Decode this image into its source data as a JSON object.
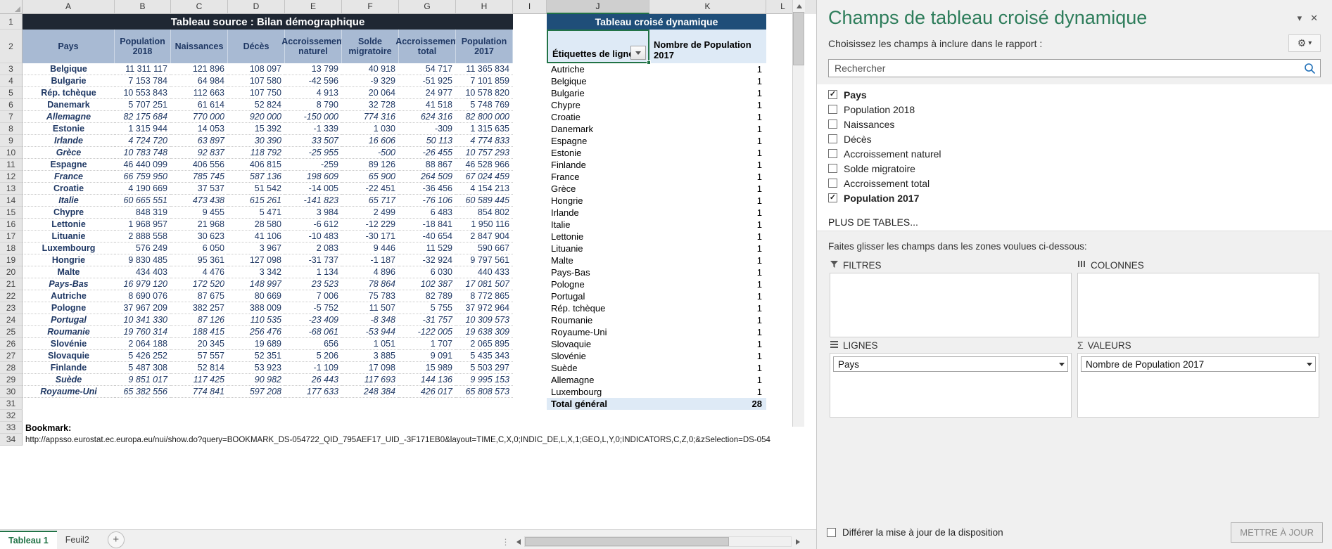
{
  "spreadsheet": {
    "column_headers": [
      "A",
      "B",
      "C",
      "D",
      "E",
      "F",
      "G",
      "H",
      "I",
      "J",
      "K",
      "L"
    ],
    "selected_column": "J",
    "row_numbers": [
      "1",
      "2",
      "3",
      "4",
      "5",
      "6",
      "7",
      "8",
      "9",
      "10",
      "11",
      "12",
      "13",
      "14",
      "15",
      "16",
      "17",
      "18",
      "19",
      "20",
      "21",
      "22",
      "23",
      "24",
      "25",
      "26",
      "27",
      "28",
      "29",
      "30",
      "31",
      "32",
      "33",
      "34"
    ],
    "source_table": {
      "banner_title": "Tableau source : Bilan démographique",
      "headers": [
        "Pays",
        "Population 2018",
        "Naissances",
        "Décès",
        "Accroissement naturel",
        "Solde migratoire",
        "Accroissement total",
        "Population 2017"
      ],
      "rows": [
        [
          "Belgique",
          "11 311 117",
          "121 896",
          "108 097",
          "13 799",
          "40 918",
          "54 717",
          "11 365 834"
        ],
        [
          "Bulgarie",
          "7 153 784",
          "64 984",
          "107 580",
          "-42 596",
          "-9 329",
          "-51 925",
          "7 101 859"
        ],
        [
          "Rép. tchèque",
          "10 553 843",
          "112 663",
          "107 750",
          "4 913",
          "20 064",
          "24 977",
          "10 578 820"
        ],
        [
          "Danemark",
          "5 707 251",
          "61 614",
          "52 824",
          "8 790",
          "32 728",
          "41 518",
          "5 748 769"
        ],
        [
          "Allemagne",
          "82 175 684",
          "770 000",
          "920 000",
          "-150 000",
          "774 316",
          "624 316",
          "82 800 000"
        ],
        [
          "Estonie",
          "1 315 944",
          "14 053",
          "15 392",
          "-1 339",
          "1 030",
          "-309",
          "1 315 635"
        ],
        [
          "Irlande",
          "4 724 720",
          "63 897",
          "30 390",
          "33 507",
          "16 606",
          "50 113",
          "4 774 833"
        ],
        [
          "Grèce",
          "10 783 748",
          "92 837",
          "118 792",
          "-25 955",
          "-500",
          "-26 455",
          "10 757 293"
        ],
        [
          "Espagne",
          "46 440 099",
          "406 556",
          "406 815",
          "-259",
          "89 126",
          "88 867",
          "46 528 966"
        ],
        [
          "France",
          "66 759 950",
          "785 745",
          "587 136",
          "198 609",
          "65 900",
          "264 509",
          "67 024 459"
        ],
        [
          "Croatie",
          "4 190 669",
          "37 537",
          "51 542",
          "-14 005",
          "-22 451",
          "-36 456",
          "4 154 213"
        ],
        [
          "Italie",
          "60 665 551",
          "473 438",
          "615 261",
          "-141 823",
          "65 717",
          "-76 106",
          "60 589 445"
        ],
        [
          "Chypre",
          "848 319",
          "9 455",
          "5 471",
          "3 984",
          "2 499",
          "6 483",
          "854 802"
        ],
        [
          "Lettonie",
          "1 968 957",
          "21 968",
          "28 580",
          "-6 612",
          "-12 229",
          "-18 841",
          "1 950 116"
        ],
        [
          "Lituanie",
          "2 888 558",
          "30 623",
          "41 106",
          "-10 483",
          "-30 171",
          "-40 654",
          "2 847 904"
        ],
        [
          "Luxembourg",
          "576 249",
          "6 050",
          "3 967",
          "2 083",
          "9 446",
          "11 529",
          "590 667"
        ],
        [
          "Hongrie",
          "9 830 485",
          "95 361",
          "127 098",
          "-31 737",
          "-1 187",
          "-32 924",
          "9 797 561"
        ],
        [
          "Malte",
          "434 403",
          "4 476",
          "3 342",
          "1 134",
          "4 896",
          "6 030",
          "440 433"
        ],
        [
          "Pays-Bas",
          "16 979 120",
          "172 520",
          "148 997",
          "23 523",
          "78 864",
          "102 387",
          "17 081 507"
        ],
        [
          "Autriche",
          "8 690 076",
          "87 675",
          "80 669",
          "7 006",
          "75 783",
          "82 789",
          "8 772 865"
        ],
        [
          "Pologne",
          "37 967 209",
          "382 257",
          "388 009",
          "-5 752",
          "11 507",
          "5 755",
          "37 972 964"
        ],
        [
          "Portugal",
          "10 341 330",
          "87 126",
          "110 535",
          "-23 409",
          "-8 348",
          "-31 757",
          "10 309 573"
        ],
        [
          "Roumanie",
          "19 760 314",
          "188 415",
          "256 476",
          "-68 061",
          "-53 944",
          "-122 005",
          "19 638 309"
        ],
        [
          "Slovénie",
          "2 064 188",
          "20 345",
          "19 689",
          "656",
          "1 051",
          "1 707",
          "2 065 895"
        ],
        [
          "Slovaquie",
          "5 426 252",
          "57 557",
          "52 351",
          "5 206",
          "3 885",
          "9 091",
          "5 435 343"
        ],
        [
          "Finlande",
          "5 487 308",
          "52 814",
          "53 923",
          "-1 109",
          "17 098",
          "15 989",
          "5 503 297"
        ],
        [
          "Suède",
          "9 851 017",
          "117 425",
          "90 982",
          "26 443",
          "117 693",
          "144 136",
          "9 995 153"
        ],
        [
          "Royaume-Uni",
          "65 382 556",
          "774 841",
          "597 208",
          "177 633",
          "248 384",
          "426 017",
          "65 808 573"
        ]
      ],
      "italic_rows": [
        4,
        6,
        7,
        9,
        11,
        18,
        21,
        22,
        26,
        27
      ],
      "bookmark_label": "Bookmark:",
      "bookmark_url": "http://appsso.eurostat.ec.europa.eu/nui/show.do?query=BOOKMARK_DS-054722_QID_795AEF17_UID_-3F171EB0&layout=TIME,C,X,0;INDIC_DE,L,X,1;GEO,L,Y,0;INDICATORS,C,Z,0;&zSelection=DS-054"
    },
    "pivot_table": {
      "banner_title": "Tableau croisé dynamique",
      "row_label_header": "Étiquettes de lignes",
      "value_header": "Nombre de Population 2017",
      "rows": [
        [
          "Autriche",
          "1"
        ],
        [
          "Belgique",
          "1"
        ],
        [
          "Bulgarie",
          "1"
        ],
        [
          "Chypre",
          "1"
        ],
        [
          "Croatie",
          "1"
        ],
        [
          "Danemark",
          "1"
        ],
        [
          "Espagne",
          "1"
        ],
        [
          "Estonie",
          "1"
        ],
        [
          "Finlande",
          "1"
        ],
        [
          "France",
          "1"
        ],
        [
          "Grèce",
          "1"
        ],
        [
          "Hongrie",
          "1"
        ],
        [
          "Irlande",
          "1"
        ],
        [
          "Italie",
          "1"
        ],
        [
          "Lettonie",
          "1"
        ],
        [
          "Lituanie",
          "1"
        ],
        [
          "Malte",
          "1"
        ],
        [
          "Pays-Bas",
          "1"
        ],
        [
          "Pologne",
          "1"
        ],
        [
          "Portugal",
          "1"
        ],
        [
          "Rép. tchèque",
          "1"
        ],
        [
          "Roumanie",
          "1"
        ],
        [
          "Royaume-Uni",
          "1"
        ],
        [
          "Slovaquie",
          "1"
        ],
        [
          "Slovénie",
          "1"
        ],
        [
          "Suède",
          "1"
        ],
        [
          "Allemagne",
          "1"
        ],
        [
          "Luxembourg",
          "1"
        ]
      ],
      "total_label": "Total général",
      "total_value": "28"
    },
    "tabs": [
      {
        "label": "Tableau 1",
        "active": true
      },
      {
        "label": "Feuil2",
        "active": false
      }
    ],
    "new_sheet_icon": "+"
  },
  "pane": {
    "title": "Champs de tableau croisé dynamique",
    "collapse_icon": "▾",
    "close_icon": "✕",
    "subtitle": "Choisissez les champs à inclure dans le rapport :",
    "gear_icon": "⚙",
    "gear_caret": "▾",
    "search": {
      "placeholder": "Rechercher",
      "value": "",
      "icon": "search-icon"
    },
    "fields": [
      {
        "label": "Pays",
        "checked": true
      },
      {
        "label": "Population 2018",
        "checked": false
      },
      {
        "label": "Naissances",
        "checked": false
      },
      {
        "label": "Décès",
        "checked": false
      },
      {
        "label": "Accroissement naturel",
        "checked": false
      },
      {
        "label": "Solde migratoire",
        "checked": false
      },
      {
        "label": "Accroissement total",
        "checked": false
      },
      {
        "label": "Population 2017",
        "checked": true
      }
    ],
    "more_tables": "PLUS DE TABLES...",
    "drag_hint": "Faites glisser les champs dans les zones voulues ci-dessous:",
    "zones": [
      {
        "name": "filters",
        "title": "FILTRES",
        "icon": "filter-icon",
        "chips": []
      },
      {
        "name": "columns",
        "title": "COLONNES",
        "icon": "columns-icon",
        "chips": []
      },
      {
        "name": "rows",
        "title": "LIGNES",
        "icon": "rows-icon",
        "chips": [
          "Pays"
        ]
      },
      {
        "name": "values",
        "title": "VALEURS",
        "icon": "sigma-icon",
        "chips": [
          "Nombre de Population 2017"
        ]
      }
    ],
    "defer_label": "Différer la mise à jour de la disposition",
    "defer_checked": false,
    "update_button": "METTRE À JOUR"
  },
  "colors": {
    "accent_green": "#2e7d5b",
    "banner_dark": "#1f2733",
    "pivot_blue": "#1f4e79",
    "header_blue": "#a8bad3",
    "text_blue": "#1f3864"
  }
}
